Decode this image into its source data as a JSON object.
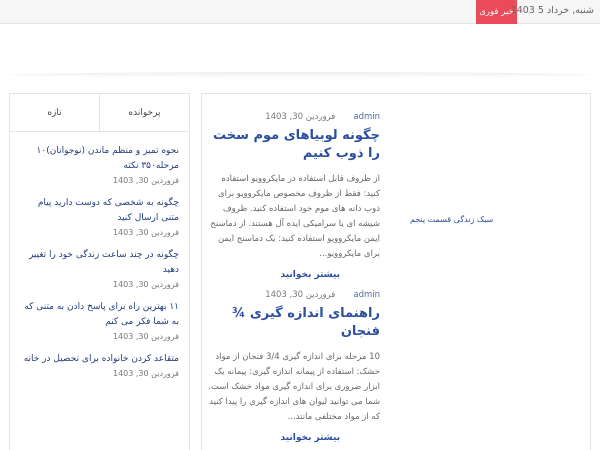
{
  "topbar": {
    "date": "شنبه, خرداد 5 1403",
    "breaking_label": "خبر فوری"
  },
  "sidebar": {
    "tabs": [
      "پرخوانده",
      "تازه"
    ],
    "items": [
      {
        "title": "نحوه تمیز و منظم ماندن (نوجوانان)۱۰ مرحله۳۵۰ نکته",
        "date": "فروردین 30, 1403"
      },
      {
        "title": "چگونه به شخصی که دوست دارید پیام متنی ارسال کنید",
        "date": "فروردین 30, 1403"
      },
      {
        "title": "چگونه در چند ساعت زندگی خود را تغییر دهید",
        "date": "فروردین 30, 1403"
      },
      {
        "title": "۱۱ بهترین راه برای پاسخ دادن به متنی که به شما فکر می کنم",
        "date": "فروردین 30, 1403"
      },
      {
        "title": "متقاعد کردن خانواده برای تحصیل در خانه",
        "date": "فروردین 30, 1403"
      }
    ]
  },
  "main": {
    "side_note": "سبک زندگی قسمت پنجم",
    "posts": [
      {
        "author": "admin",
        "date": "فروردین 30, 1403",
        "title": "چگونه لوبیاهای موم سخت را ذوب کنیم",
        "excerpt": "از ظروف قابل استفاده در مایکروویو استفاده کنید: فقط از ظروف مخصوص مایکروویو برای ذوب دانه های موم خود استفاده کنید. ظروف شیشه ای یا سرامیکی ایده آل هستند. از دماسنج ایمن مایکروویو استفاده کنید: یک دماسنج ایمن برای مایکروویو...",
        "more": "بیشتر بخوانید"
      },
      {
        "author": "admin",
        "date": "فروردین 30, 1403",
        "title": "راهنمای اندازه گیری ¾ فنجان",
        "excerpt": "10 مرحله برای اندازه گیری 3/4 فنجان از مواد خشک: استفاده از پیمانه اندازه گیری: پیمانه یک ابزار ضروری برای اندازه گیری مواد خشک است. شما می توانید لیوان های اندازه گیری را پیدا کنید که از مواد مختلفی مانند...",
        "more": "بیشتر بخوانید"
      }
    ]
  }
}
